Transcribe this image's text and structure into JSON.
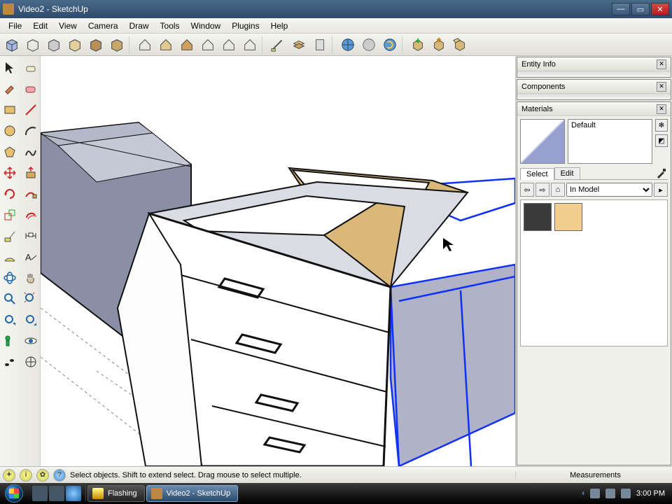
{
  "window": {
    "title": "Video2 - SketchUp"
  },
  "menu": {
    "items": [
      "File",
      "Edit",
      "View",
      "Camera",
      "Draw",
      "Tools",
      "Window",
      "Plugins",
      "Help"
    ]
  },
  "panels": {
    "entity_info": {
      "title": "Entity Info"
    },
    "components": {
      "title": "Components"
    },
    "materials": {
      "title": "Materials",
      "current_name": "Default",
      "tabs": {
        "select": "Select",
        "edit": "Edit"
      },
      "library_select": "In Model",
      "swatches": [
        {
          "name": "dark-gray",
          "color": "#3a3a3a"
        },
        {
          "name": "wood-tan",
          "color": "#f2cf8e"
        }
      ]
    }
  },
  "status": {
    "hint": "Select objects. Shift to extend select. Drag mouse to select multiple.",
    "measurements_label": "Measurements"
  },
  "taskbar": {
    "buttons": [
      {
        "label": "Flashing",
        "active": false
      },
      {
        "label": "Video2 - SketchUp",
        "active": true
      }
    ],
    "clock": "3:00 PM"
  }
}
